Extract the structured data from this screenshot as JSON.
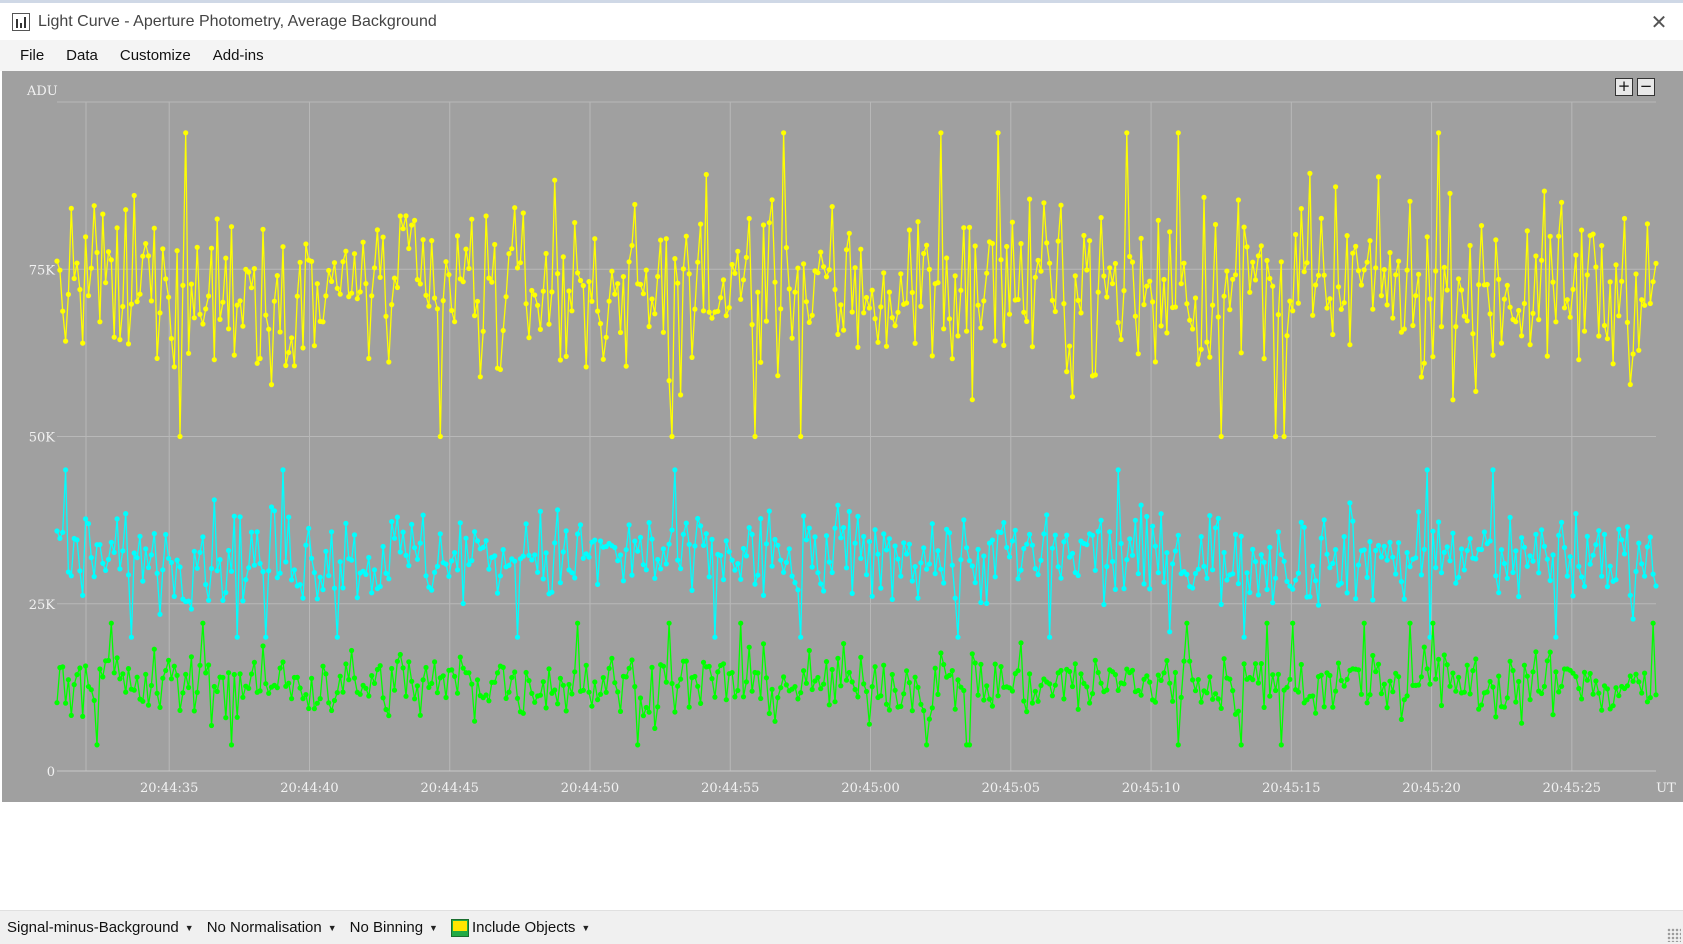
{
  "window": {
    "title": "Light Curve - Aperture Photometry, Average Background"
  },
  "menu": {
    "items": [
      "File",
      "Data",
      "Customize",
      "Add-ins"
    ]
  },
  "zoom": {
    "plus": "+",
    "minus": "−"
  },
  "chart_data": {
    "type": "scatter",
    "ylabel": "ADU",
    "xlabel": "UT",
    "ylim": [
      0,
      100000
    ],
    "y_ticks": [
      "0",
      "25K",
      "50K",
      "75K"
    ],
    "y_tick_values": [
      0,
      25000,
      50000,
      75000
    ],
    "x_ticks": [
      "20:44:35",
      "20:44:40",
      "20:44:45",
      "20:44:50",
      "20:44:55",
      "20:45:00",
      "20:45:05",
      "20:45:10",
      "20:45:15",
      "20:45:20",
      "20:45:25"
    ],
    "xlim": [
      "20:44:31",
      "20:45:28"
    ],
    "grid": true,
    "series": [
      {
        "color": "#ffff00",
        "mean": 72000,
        "spread": 9000,
        "min": 50000,
        "max": 99000
      },
      {
        "color": "#00ffff",
        "mean": 32000,
        "spread": 5000,
        "min": 20000,
        "max": 48000
      },
      {
        "color": "#00ff00",
        "mean": 13000,
        "spread": 3500,
        "min": 3000,
        "max": 25000
      }
    ]
  },
  "status": {
    "mode": "Signal-minus-Background",
    "normalisation": "No Normalisation",
    "binning": "No Binning",
    "objects": "Include Objects"
  }
}
